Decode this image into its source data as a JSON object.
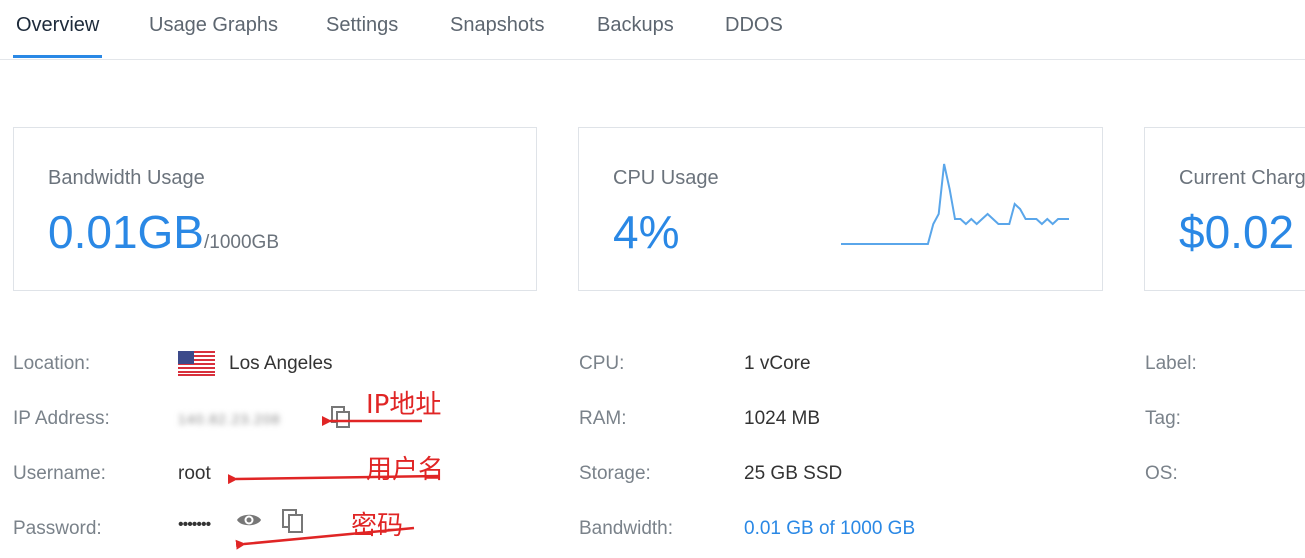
{
  "tabs": [
    {
      "label": "Overview",
      "active": true
    },
    {
      "label": "Usage Graphs",
      "active": false
    },
    {
      "label": "Settings",
      "active": false
    },
    {
      "label": "Snapshots",
      "active": false
    },
    {
      "label": "Backups",
      "active": false
    },
    {
      "label": "DDOS",
      "active": false
    }
  ],
  "cards": {
    "bandwidth": {
      "label": "Bandwidth Usage",
      "value": "0.01GB",
      "unit": "/1000GB"
    },
    "cpu": {
      "label": "CPU Usage",
      "value": "4%"
    },
    "charges": {
      "label": "Current Charges",
      "value": "$0.02"
    }
  },
  "cpu_sparkline": {
    "points": [
      0,
      0,
      0,
      0,
      0,
      0,
      0,
      0,
      0,
      0,
      0,
      0,
      0,
      0,
      0,
      0,
      0,
      4,
      6,
      16,
      11,
      5,
      5,
      4,
      5,
      4,
      5,
      6,
      5,
      4,
      4,
      4,
      8,
      7,
      5,
      5,
      5,
      4,
      5,
      4,
      5,
      5,
      5
    ]
  },
  "info": {
    "location": {
      "label": "Location:",
      "value": "Los Angeles"
    },
    "ip": {
      "label": "IP Address:",
      "value": "140.82.23.208"
    },
    "username": {
      "label": "Username:",
      "value": "root"
    },
    "password": {
      "label": "Password:",
      "value": "•••••••"
    },
    "cpu": {
      "label": "CPU:",
      "value": "1 vCore"
    },
    "ram": {
      "label": "RAM:",
      "value": "1024 MB"
    },
    "storage": {
      "label": "Storage:",
      "value": "25 GB SSD"
    },
    "bandwidth": {
      "label": "Bandwidth:",
      "value": "0.01 GB of 1000 GB"
    },
    "label": {
      "label": "Label:"
    },
    "tag": {
      "label": "Tag:"
    },
    "os": {
      "label": "OS:"
    }
  },
  "annotations": {
    "ip": "IP地址",
    "username": "用户名",
    "password": "密码"
  },
  "colors": {
    "accent": "#2a88e5",
    "annotation": "#e02525"
  },
  "icons": {
    "flag": "us-flag-icon",
    "copy": "copy-icon",
    "eye": "eye-icon"
  }
}
